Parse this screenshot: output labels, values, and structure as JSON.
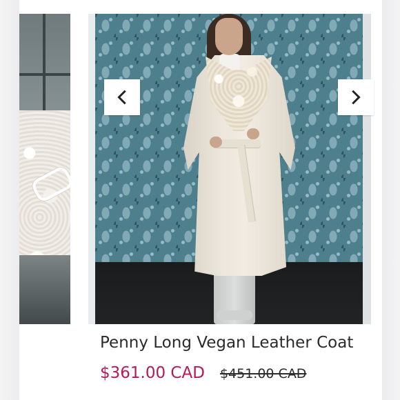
{
  "carousel": {
    "prev_icon": "chevron-left-icon",
    "next_icon": "chevron-right-icon"
  },
  "product": {
    "title": "Penny Long Vegan Leather Coat",
    "price": "$361.00 CAD",
    "original_price": "$451.00 CAD"
  },
  "colors": {
    "price": "#b8185a",
    "text": "#2b2b2b",
    "background": "#ffffff"
  }
}
